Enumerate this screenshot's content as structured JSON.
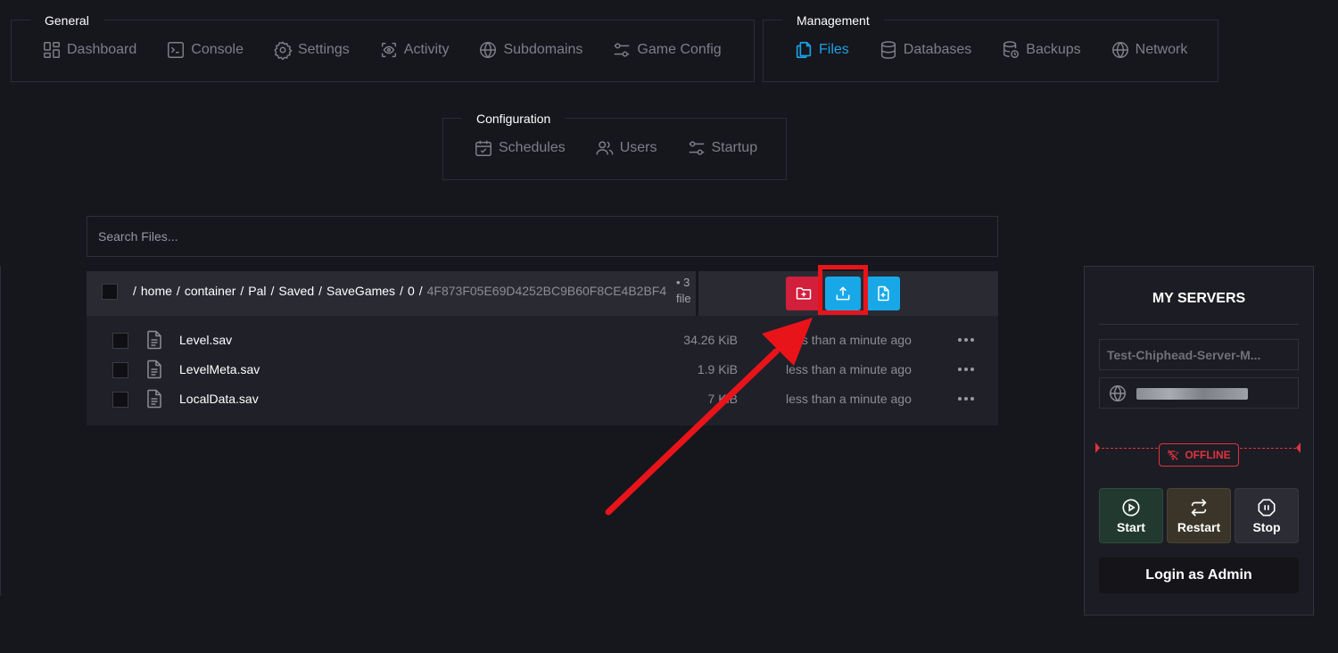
{
  "nav": {
    "general": {
      "title": "General",
      "items": [
        "Dashboard",
        "Console",
        "Settings",
        "Activity",
        "Subdomains",
        "Game Config"
      ]
    },
    "management": {
      "title": "Management",
      "items": [
        "Files",
        "Databases",
        "Backups",
        "Network"
      ],
      "active": "Files"
    },
    "configuration": {
      "title": "Configuration",
      "items": [
        "Schedules",
        "Users",
        "Startup"
      ]
    }
  },
  "search": {
    "placeholder": "Search Files..."
  },
  "file_manager": {
    "breadcrumb": [
      "home",
      "container",
      "Pal",
      "Saved",
      "SaveGames",
      "0",
      "4F873F05E69D4252BC9B60F8CE4B2BF4"
    ],
    "count_line1": "• 3",
    "count_line2": "file",
    "actions": [
      "new-folder",
      "upload",
      "new-file"
    ],
    "files": [
      {
        "name": "Level.sav",
        "size": "34.26 KiB",
        "modified": "less than a minute ago"
      },
      {
        "name": "LevelMeta.sav",
        "size": "1.9 KiB",
        "modified": "less than a minute ago"
      },
      {
        "name": "LocalData.sav",
        "size": "7 KiB",
        "modified": "less than a minute ago"
      }
    ]
  },
  "servers": {
    "title": "MY SERVERS",
    "server_name": "Test-Chiphead-Server-M...",
    "status": "OFFLINE",
    "buttons": {
      "start": "Start",
      "restart": "Restart",
      "stop": "Stop"
    },
    "login": "Login as Admin"
  },
  "colors": {
    "accent": "#1aa2e6",
    "danger": "#d11f3c",
    "offline": "#e0343f",
    "annotation": "#e8141a"
  }
}
